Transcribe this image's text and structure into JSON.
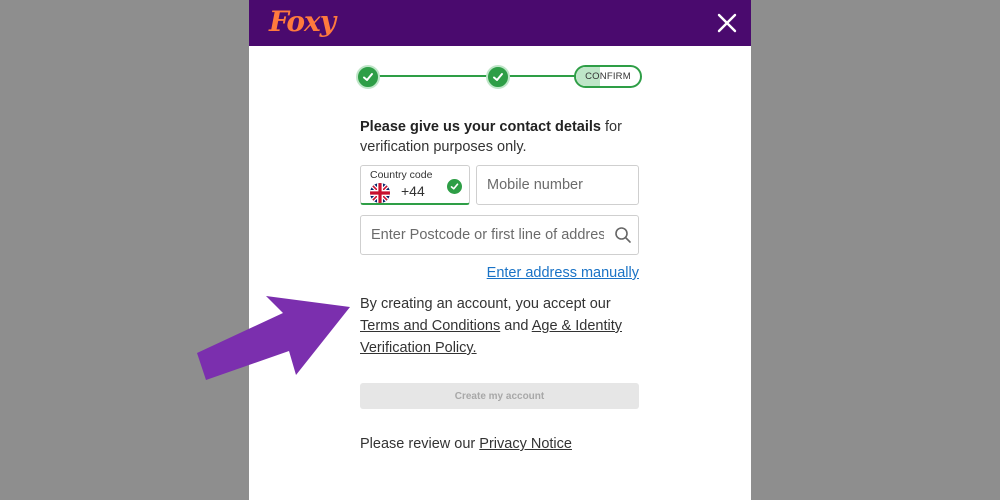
{
  "brand": {
    "logo_text": "Foxy",
    "logo_color": "#ff7a3d",
    "header_color": "#4a0a6e"
  },
  "progress": {
    "completed_steps": 2,
    "current_step_label": "CONFIRM",
    "accent_color": "#2e9e46"
  },
  "intro": {
    "bold": "Please give us your contact details",
    "rest": " for verification purposes only."
  },
  "country_code": {
    "label": "Country code",
    "value": "+44",
    "flag": "uk-flag-icon"
  },
  "mobile": {
    "placeholder": "Mobile number"
  },
  "postcode": {
    "placeholder": "Enter Postcode or first line of address"
  },
  "manual_link": "Enter address manually",
  "terms": {
    "prefix": "By creating an account, you accept our ",
    "terms_link": "Terms and Conditions",
    "and": " and ",
    "policy_link": "Age & Identity Verification Policy."
  },
  "create_button": "Create my account",
  "privacy": {
    "prefix": "Please review our ",
    "link": "Privacy Notice"
  },
  "annotation": {
    "arrow_color": "#7b2fae"
  }
}
